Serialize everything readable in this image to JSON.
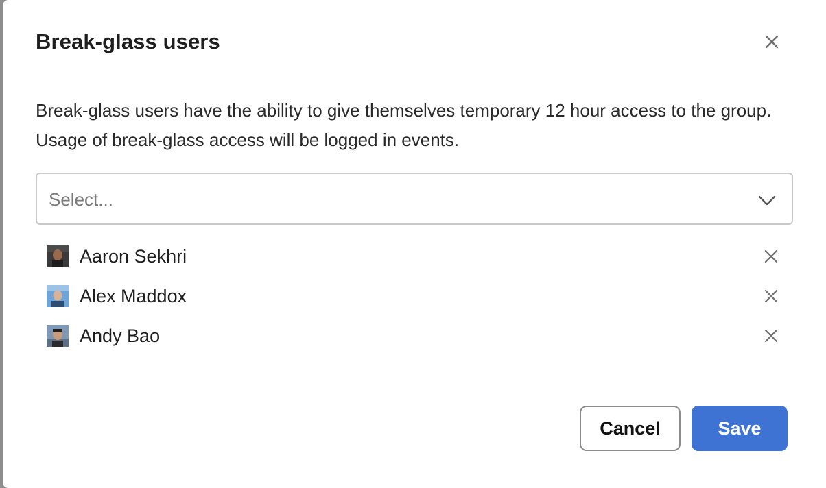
{
  "modal": {
    "title": "Break-glass users",
    "description": "Break-glass users have the ability to give themselves temporary 12 hour access to the group. Usage of break-glass access will be logged in events."
  },
  "select": {
    "placeholder": "Select...",
    "icon": "chevron-down-icon"
  },
  "users": [
    {
      "name": "Aaron Sekhri",
      "avatar": "avatar-aaron-sekhri",
      "avatar_bg": "#3a3a3a",
      "avatar_skin": "#9a6a4e"
    },
    {
      "name": "Alex Maddox",
      "avatar": "avatar-alex-maddox",
      "avatar_bg": "#6fa4d8",
      "avatar_skin": "#d7b39a"
    },
    {
      "name": "Andy Bao",
      "avatar": "avatar-andy-bao",
      "avatar_bg": "#7f98b6",
      "avatar_skin": "#c79d7d"
    }
  ],
  "actions": {
    "cancel_label": "Cancel",
    "save_label": "Save"
  },
  "colors": {
    "primary": "#3f73d3",
    "border": "#c9c9c9",
    "icon": "#6e6e6e"
  }
}
